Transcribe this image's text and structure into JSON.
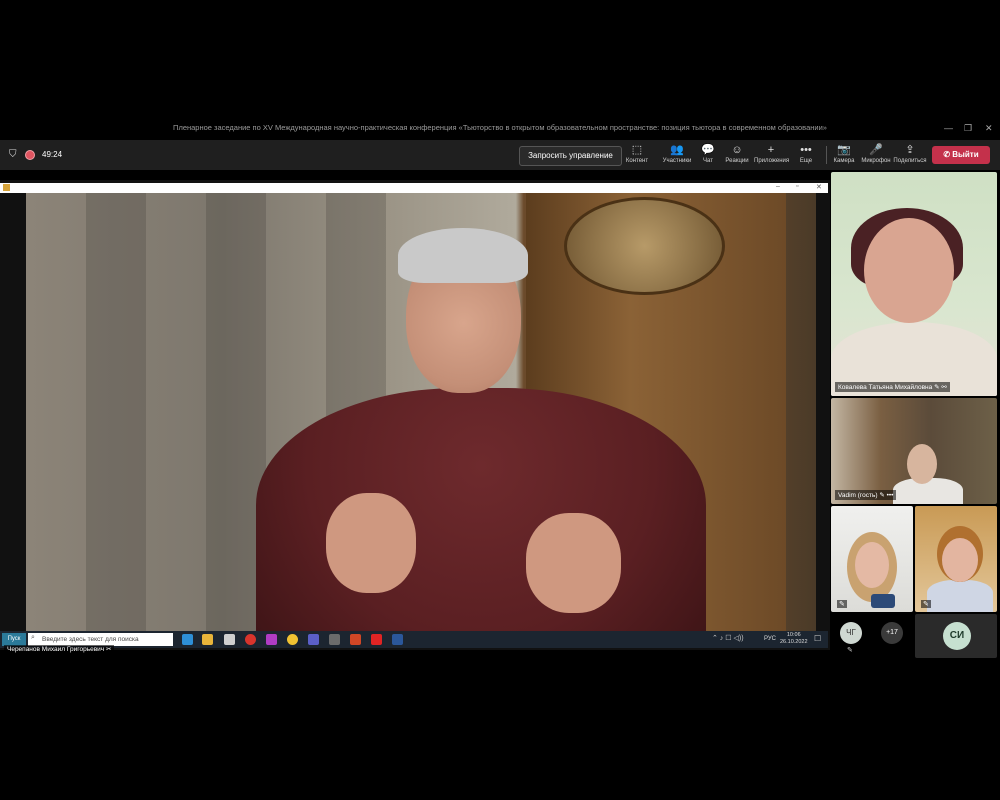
{
  "window": {
    "title": "Пленарное заседание по XV Международная научно-практическая конференция «Тьюторство в открытом образовательном пространстве: позиция тьютора в современном образовании»",
    "controls": [
      "—",
      "❐",
      "✕"
    ]
  },
  "toolbar": {
    "timer": "49:24",
    "request_control": "Запросить управление",
    "buttons": [
      {
        "icon": "content-icon",
        "glyph": "⬚",
        "label": "Контент"
      },
      {
        "icon": "people-icon",
        "glyph": "👥",
        "label": "Участники"
      },
      {
        "icon": "chat-icon",
        "glyph": "💬",
        "label": "Чат"
      },
      {
        "icon": "reactions-icon",
        "glyph": "☺",
        "label": "Реакции"
      },
      {
        "icon": "apps-icon",
        "glyph": "+",
        "label": "Приложения"
      },
      {
        "icon": "more-icon",
        "glyph": "•••",
        "label": "Еще"
      },
      {
        "icon": "camera-icon",
        "glyph": "📷",
        "label": "Камера"
      },
      {
        "icon": "mic-icon",
        "glyph": "🎤",
        "label": "Микрофон"
      },
      {
        "icon": "share-icon",
        "glyph": "⇪",
        "label": "Поделиться"
      }
    ],
    "leave": "Выйти",
    "leave_color": "#c4314b"
  },
  "shared_screen": {
    "search_placeholder": "Введите здесь текст для поиска",
    "start_label": "Пуск",
    "tray_lang": "РУС",
    "tray_time": "10:06",
    "tray_date": "26.10.2022",
    "speaker_name": "Черепанов Михаил Григорьевич"
  },
  "participants": [
    {
      "name": "Ковалева Татьяна Михайловна"
    },
    {
      "name": "Vadim (гость)"
    }
  ],
  "avatars": {
    "first": "ЧГ",
    "more": "+17",
    "self": "СИ"
  }
}
